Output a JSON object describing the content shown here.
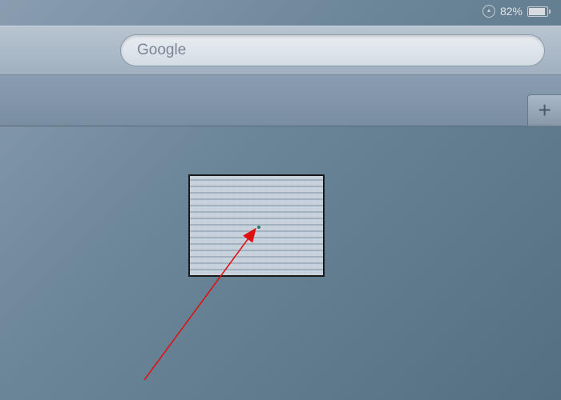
{
  "status": {
    "battery_percent": "82%",
    "battery_level": 82
  },
  "toolbar": {
    "search_placeholder": "Google"
  },
  "tabs": {
    "add_label": "+"
  }
}
